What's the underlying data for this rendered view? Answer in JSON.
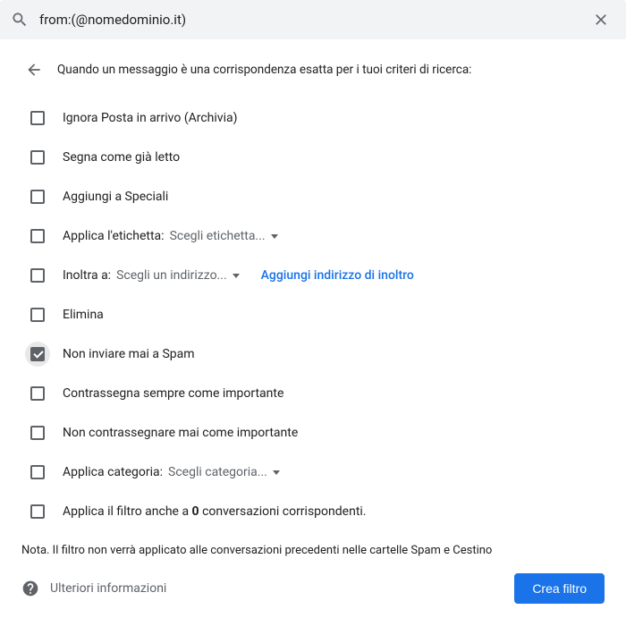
{
  "search": {
    "query": "from:(@nomedominio.it)"
  },
  "header": {
    "text": "Quando un messaggio è una corrispondenza esatta per i tuoi criteri di ricerca:"
  },
  "options": {
    "archive": "Ignora Posta in arrivo (Archivia)",
    "mark_read": "Segna come già letto",
    "star": "Aggiungi a Speciali",
    "apply_label_prefix": "Applica l'etichetta:",
    "apply_label_dropdown": "Scegli etichetta...",
    "forward_prefix": "Inoltra a:",
    "forward_dropdown": "Scegli un indirizzo...",
    "forward_add_link": "Aggiungi indirizzo di inoltro",
    "delete": "Elimina",
    "never_spam": "Non inviare mai a Spam",
    "always_important": "Contrassegna sempre come importante",
    "never_important": "Non contrassegnare mai come importante",
    "apply_category_prefix": "Applica categoria:",
    "apply_category_dropdown": "Scegli categoria...",
    "apply_existing_before": "Applica il filtro anche a ",
    "apply_existing_count": "0",
    "apply_existing_after": " conversazioni corrispondenti."
  },
  "note": "Nota. Il filtro non verrà applicato alle conversazioni precedenti nelle cartelle Spam e Cestino",
  "footer": {
    "more_info": "Ulteriori informazioni",
    "create_button": "Crea filtro"
  }
}
